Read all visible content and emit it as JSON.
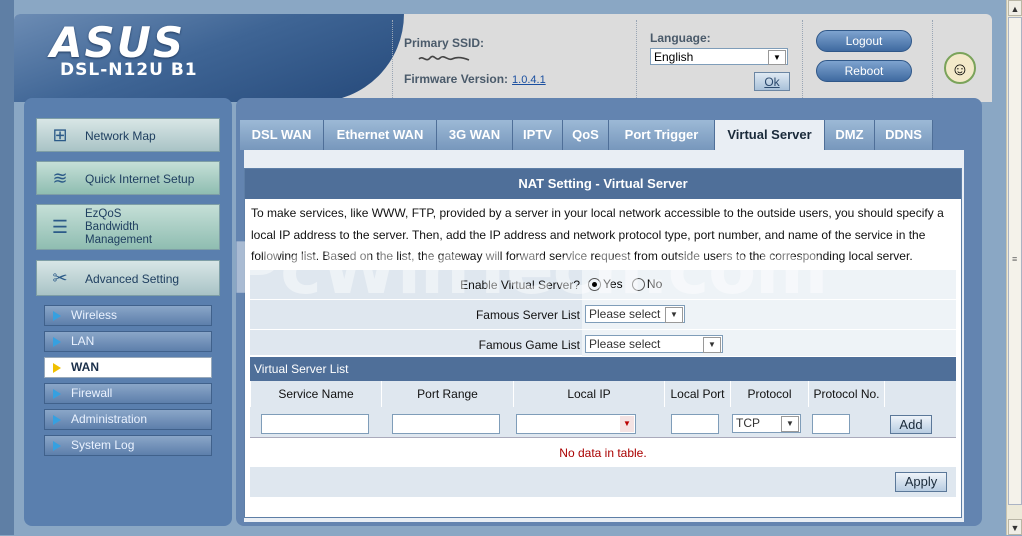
{
  "header": {
    "logo": "ASUS",
    "model": "DSL-N12U B1",
    "primary_ssid_label": "Primary SSID:",
    "firmware_label": "Firmware Version:",
    "firmware_value": "1.0.4.1",
    "language_label": "Language:",
    "language_value": "English",
    "ok_label": "Ok",
    "logout_label": "Logout",
    "reboot_label": "Reboot"
  },
  "sidebar": {
    "main_items": [
      {
        "label": "Network Map",
        "icon": "network-map-icon"
      },
      {
        "label": "Quick Internet Setup",
        "icon": "router-icon"
      },
      {
        "label": "EzQoS\nBandwidth\nManagement",
        "icon": "qos-icon"
      },
      {
        "label": "Advanced Setting",
        "icon": "tools-icon"
      }
    ],
    "sub_items": [
      {
        "label": "Wireless"
      },
      {
        "label": "LAN"
      },
      {
        "label": "WAN"
      },
      {
        "label": "Firewall"
      },
      {
        "label": "Administration"
      },
      {
        "label": "System Log"
      }
    ]
  },
  "tabs": [
    {
      "label": "DSL WAN"
    },
    {
      "label": "Ethernet WAN"
    },
    {
      "label": "3G WAN"
    },
    {
      "label": "IPTV"
    },
    {
      "label": "QoS"
    },
    {
      "label": "Port Trigger"
    },
    {
      "label": "Virtual Server"
    },
    {
      "label": "DMZ"
    },
    {
      "label": "DDNS"
    }
  ],
  "panel": {
    "title": "NAT Setting - Virtual Server",
    "description": "To make services, like WWW, FTP, provided by a server in your local network accessible to the outside users, you should specify a local IP address to the server. Then, add the IP address and network protocol type, port number, and name of the service in the following list. Based on the list, the gateway will forward service request from outside users to the corresponding local server.",
    "enable_label": "Enable Virtual Server?",
    "yes_label": "Yes",
    "no_label": "No",
    "famous_server_label": "Famous Server List",
    "famous_server_value": "Please select",
    "famous_game_label": "Famous Game List",
    "famous_game_value": "Please select",
    "list_header": "Virtual Server List",
    "columns": [
      "Service Name",
      "Port Range",
      "Local IP",
      "Local Port",
      "Protocol",
      "Protocol No."
    ],
    "protocol_value": "TCP",
    "add_label": "Add",
    "no_data": "No data in table.",
    "apply_label": "Apply"
  },
  "watermark": "PcWinTech.com"
}
